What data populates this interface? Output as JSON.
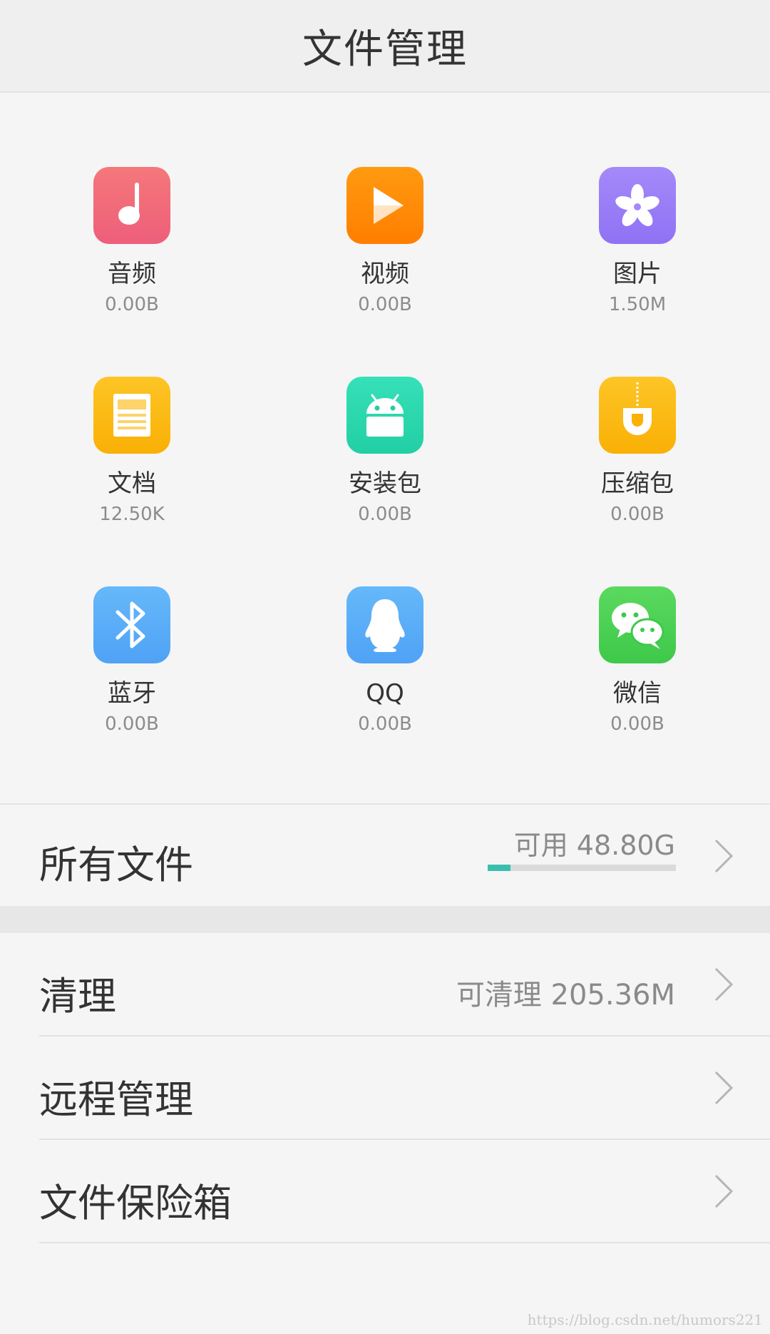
{
  "header": {
    "title": "文件管理"
  },
  "categories": [
    {
      "label": "音频",
      "size": "0.00B",
      "icon": "music-note-icon",
      "color": "#f06a7a"
    },
    {
      "label": "视频",
      "size": "0.00B",
      "icon": "play-icon",
      "color": "#ff8a00"
    },
    {
      "label": "图片",
      "size": "1.50M",
      "icon": "flower-icon",
      "color": "#9a7ef8"
    },
    {
      "label": "文档",
      "size": "12.50K",
      "icon": "document-icon",
      "color": "#fbbc10"
    },
    {
      "label": "安装包",
      "size": "0.00B",
      "icon": "android-icon",
      "color": "#2fd8b0"
    },
    {
      "label": "压缩包",
      "size": "0.00B",
      "icon": "zip-icon",
      "color": "#fbbc10"
    },
    {
      "label": "蓝牙",
      "size": "0.00B",
      "icon": "bluetooth-icon",
      "color": "#5aaef8"
    },
    {
      "label": "QQ",
      "size": "0.00B",
      "icon": "qq-penguin-icon",
      "color": "#5aaef8"
    },
    {
      "label": "微信",
      "size": "0.00B",
      "icon": "wechat-icon",
      "color": "#46d35a"
    }
  ],
  "all_files": {
    "title": "所有文件",
    "available": "可用 48.80G",
    "used_fraction": 0.12,
    "accent": "#3bbfad"
  },
  "rows": [
    {
      "title": "清理",
      "value": "可清理 205.36M"
    },
    {
      "title": "远程管理",
      "value": ""
    },
    {
      "title": "文件保险箱",
      "value": ""
    }
  ],
  "watermark": "https://blog.csdn.net/humors221"
}
